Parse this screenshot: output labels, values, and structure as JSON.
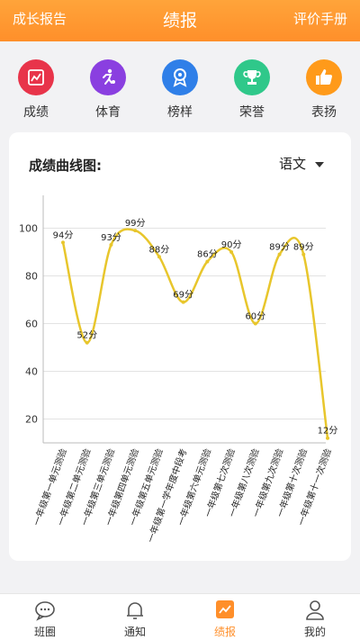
{
  "header": {
    "left": "成长报告",
    "title": "绩报",
    "right": "评价手册"
  },
  "quick": [
    {
      "label": "成绩",
      "icon": "report-chart-icon",
      "color": "#e8344a"
    },
    {
      "label": "体育",
      "icon": "sport-runner-icon",
      "color": "#8a3fe0"
    },
    {
      "label": "榜样",
      "icon": "medal-icon",
      "color": "#2f7fe8"
    },
    {
      "label": "荣誉",
      "icon": "trophy-icon",
      "color": "#2fc88a"
    },
    {
      "label": "表扬",
      "icon": "thumbs-up-icon",
      "color": "#ff9a1a"
    }
  ],
  "card": {
    "title": "成绩曲线图:",
    "subject": "语文"
  },
  "chart_data": {
    "type": "line",
    "categories": [
      "一年级第一单元测验",
      "一年级第二单元测验",
      "一年级第三单元测验",
      "一年级第四单元测验",
      "一年级第五单元测验",
      "一年级第一学年度中段考",
      "一年级第六单元测验",
      "一年级第七次测验",
      "一年级第八次测验",
      "一年级第九次测验",
      "一年级第十次测验",
      "一年级第十一次测验"
    ],
    "values": [
      94,
      52,
      93,
      99,
      88,
      69,
      86,
      90,
      60,
      89,
      89,
      12
    ],
    "value_labels": [
      "94分",
      "52分",
      "93分",
      "99分",
      "88分",
      "69分",
      "86分",
      "90分",
      "60分",
      "89分",
      "89分",
      "12分"
    ],
    "yticks": [
      "20",
      "40",
      "60",
      "80",
      "100"
    ],
    "ylim": [
      10,
      110
    ],
    "line_color": "#e8c62c",
    "grid": true
  },
  "tabs": [
    {
      "label": "班圈",
      "icon": "chat-bubble-icon",
      "active": false
    },
    {
      "label": "通知",
      "icon": "bell-icon",
      "active": false
    },
    {
      "label": "绩报",
      "icon": "report-icon",
      "active": true
    },
    {
      "label": "我的",
      "icon": "person-icon",
      "active": false
    }
  ],
  "colors": {
    "accent": "#ff8f2a"
  }
}
